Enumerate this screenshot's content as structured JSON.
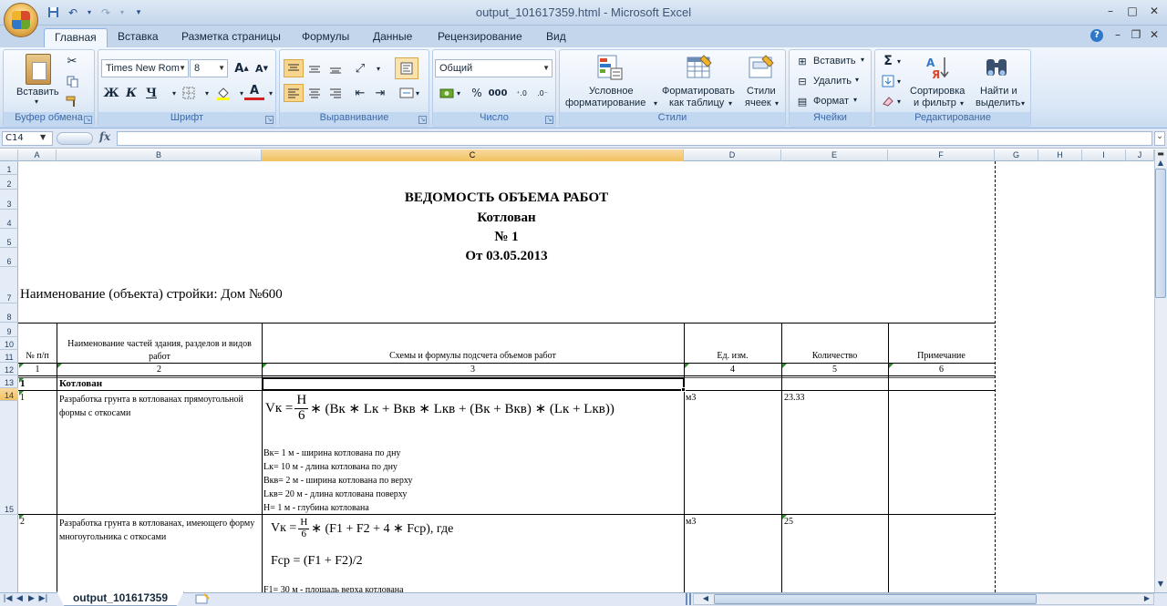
{
  "window": {
    "title": "output_101617359.html - Microsoft Excel",
    "controls": {
      "minimize": "–",
      "maximize": "□",
      "close": "✕"
    },
    "doc_controls": {
      "minimize": "–",
      "restore": "❐",
      "close": "✕"
    }
  },
  "ribbon": {
    "tabs": [
      "Главная",
      "Вставка",
      "Разметка страницы",
      "Формулы",
      "Данные",
      "Рецензирование",
      "Вид"
    ],
    "clipboard": {
      "paste": "Вставить",
      "label": "Буфер обмена"
    },
    "font": {
      "name": "Times New Rom",
      "size": "8",
      "bold": "Ж",
      "italic": "К",
      "underline": "Ч",
      "label": "Шрифт"
    },
    "alignment": {
      "label": "Выравнивание"
    },
    "number": {
      "format": "Общий",
      "percent": "%",
      "thousands": "000",
      "label": "Число"
    },
    "styles": {
      "conditional": "Условное",
      "conditional2": "форматирование",
      "as_table": "Форматировать",
      "as_table2": "как таблицу",
      "cell_styles": "Стили",
      "cell_styles2": "ячеек",
      "label": "Стили"
    },
    "cells": {
      "insert": "Вставить",
      "delete": "Удалить",
      "format": "Формат",
      "label": "Ячейки"
    },
    "editing": {
      "sigma": "Σ",
      "sort": "Сортировка",
      "sort2": "и фильтр",
      "find": "Найти и",
      "find2": "выделить",
      "label": "Редактирование"
    }
  },
  "formula_bar": {
    "name_box": "C14",
    "fx": "fx",
    "content": ""
  },
  "columns": [
    "A",
    "B",
    "C",
    "D",
    "E",
    "F",
    "G",
    "H",
    "I",
    "J"
  ],
  "selected_column": "C",
  "rows": [
    "1",
    "2",
    "3",
    "4",
    "5",
    "6",
    "7",
    "8",
    "9",
    "10",
    "11",
    "12",
    "13",
    "14",
    "15"
  ],
  "selected_row": "14",
  "sheet": {
    "title1": "ВЕДОМОСТЬ ОБЪЕМА РАБОТ",
    "title2": "Котлован",
    "title3": "№ 1",
    "title4": "От 03.05.2013",
    "object_name": "Наименование (объекта) стройки: Дом №600",
    "headers": {
      "num": "№ п/п",
      "parts": "Наименование частей здания, разделов и видов работ",
      "schemes": "Схемы и формулы подсчета объемов работ",
      "unit": "Ед. изм.",
      "qty": "Количество",
      "note": "Примечание"
    },
    "header_nums": [
      "1",
      "2",
      "3",
      "4",
      "5",
      "6"
    ],
    "section": {
      "num": "1",
      "name": "Котлован"
    },
    "items": [
      {
        "num": "1",
        "name": "Разработка грунта в котлованах прямоугольной формы с откосами",
        "formula_lhs": "Vк =",
        "frac_n": "H",
        "frac_d": "6",
        "formula_rhs": "∗ (Bк ∗ Lк + Bкв ∗ Lкв + (Bк + Bкв) ∗ (Lк + Lкв))",
        "notes": [
          "Вк= 1 м - ширина котлована по дну",
          "Lк= 10 м - длина котлована по дну",
          "Вкв= 2 м - ширина котлована по верху",
          "Lкв= 20 м - длина котлована поверху",
          "Н= 1 м - глубина котлована"
        ],
        "unit": "м3",
        "qty": "23.33"
      },
      {
        "num": "2",
        "name": "Разработка грунта в котлованах, имеющего форму многоугольника с откосами",
        "formula_lhs": "Vк =",
        "frac_n": "H",
        "frac_d": "6",
        "formula_rhs": "∗ (F1 + F2 + 4 ∗ Fср), где",
        "formula2": "Fср = (F1 + F2)/2",
        "notes": [
          "F1= 30 м - площадь верха котлована"
        ],
        "unit": "м3",
        "qty": "25"
      }
    ]
  },
  "sheet_tab": "output_101617359"
}
